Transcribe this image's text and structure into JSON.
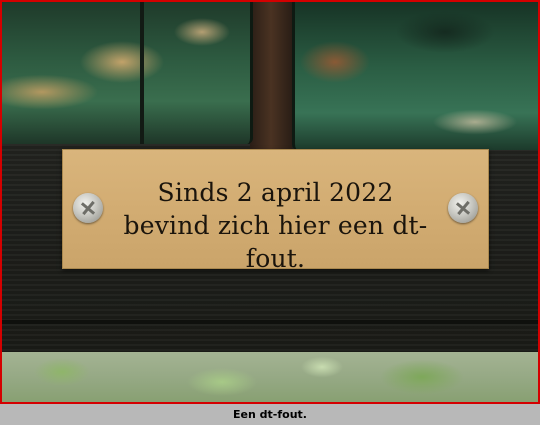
{
  "plaque": {
    "line1": "Sinds 2 april 2022",
    "line2": "bevind zich hier een dt-fout."
  },
  "caption": "Een dt-fout.",
  "colors": {
    "frame_border": "#d40000",
    "plaque_brass": "#d3ad73",
    "plaque_text": "#1a140c",
    "beam_green": "#2d5a40",
    "board_dark": "#1d1e1a",
    "caption_bg": "#b8b8b8"
  }
}
